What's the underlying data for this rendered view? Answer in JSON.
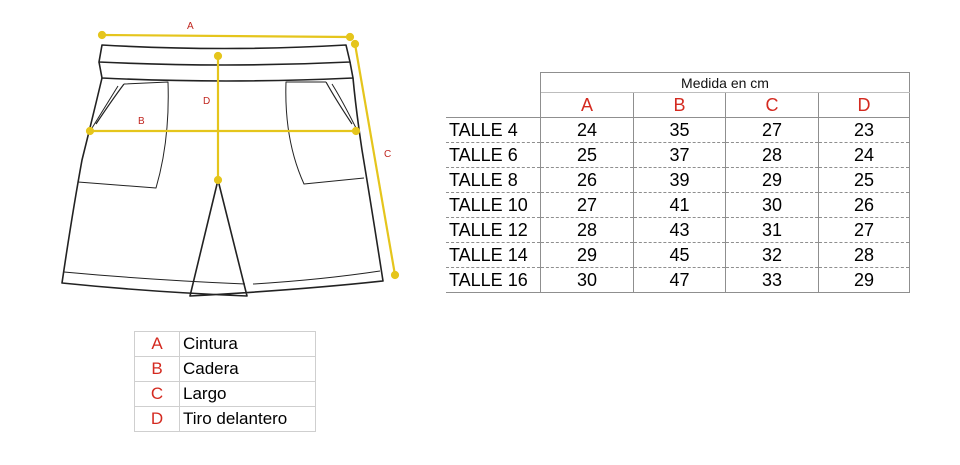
{
  "diagram": {
    "dimension_labels": {
      "a": "A",
      "b": "B",
      "c": "C",
      "d": "D"
    },
    "colors": {
      "measure_line": "#e5c51c",
      "label": "#c0261f",
      "garment_outline": "#222222"
    }
  },
  "size_table": {
    "title": "Medida en cm",
    "columns": [
      "A",
      "B",
      "C",
      "D"
    ],
    "rows": [
      {
        "label": "TALLE 4",
        "values": [
          "24",
          "35",
          "27",
          "23"
        ]
      },
      {
        "label": "TALLE 6",
        "values": [
          "25",
          "37",
          "28",
          "24"
        ]
      },
      {
        "label": "TALLE 8",
        "values": [
          "26",
          "39",
          "29",
          "25"
        ]
      },
      {
        "label": "TALLE 10",
        "values": [
          "27",
          "41",
          "30",
          "26"
        ]
      },
      {
        "label": "TALLE 12",
        "values": [
          "28",
          "43",
          "31",
          "27"
        ]
      },
      {
        "label": "TALLE 14",
        "values": [
          "29",
          "45",
          "32",
          "28"
        ]
      },
      {
        "label": "TALLE 16",
        "values": [
          "30",
          "47",
          "33",
          "29"
        ]
      }
    ],
    "colors": {
      "letters": "#d42a20",
      "borders": "#8f8f8f"
    }
  },
  "legend": [
    {
      "letter": "A",
      "name": "Cintura"
    },
    {
      "letter": "B",
      "name": "Cadera"
    },
    {
      "letter": "C",
      "name": "Largo"
    },
    {
      "letter": "D",
      "name": "Tiro delantero"
    }
  ]
}
